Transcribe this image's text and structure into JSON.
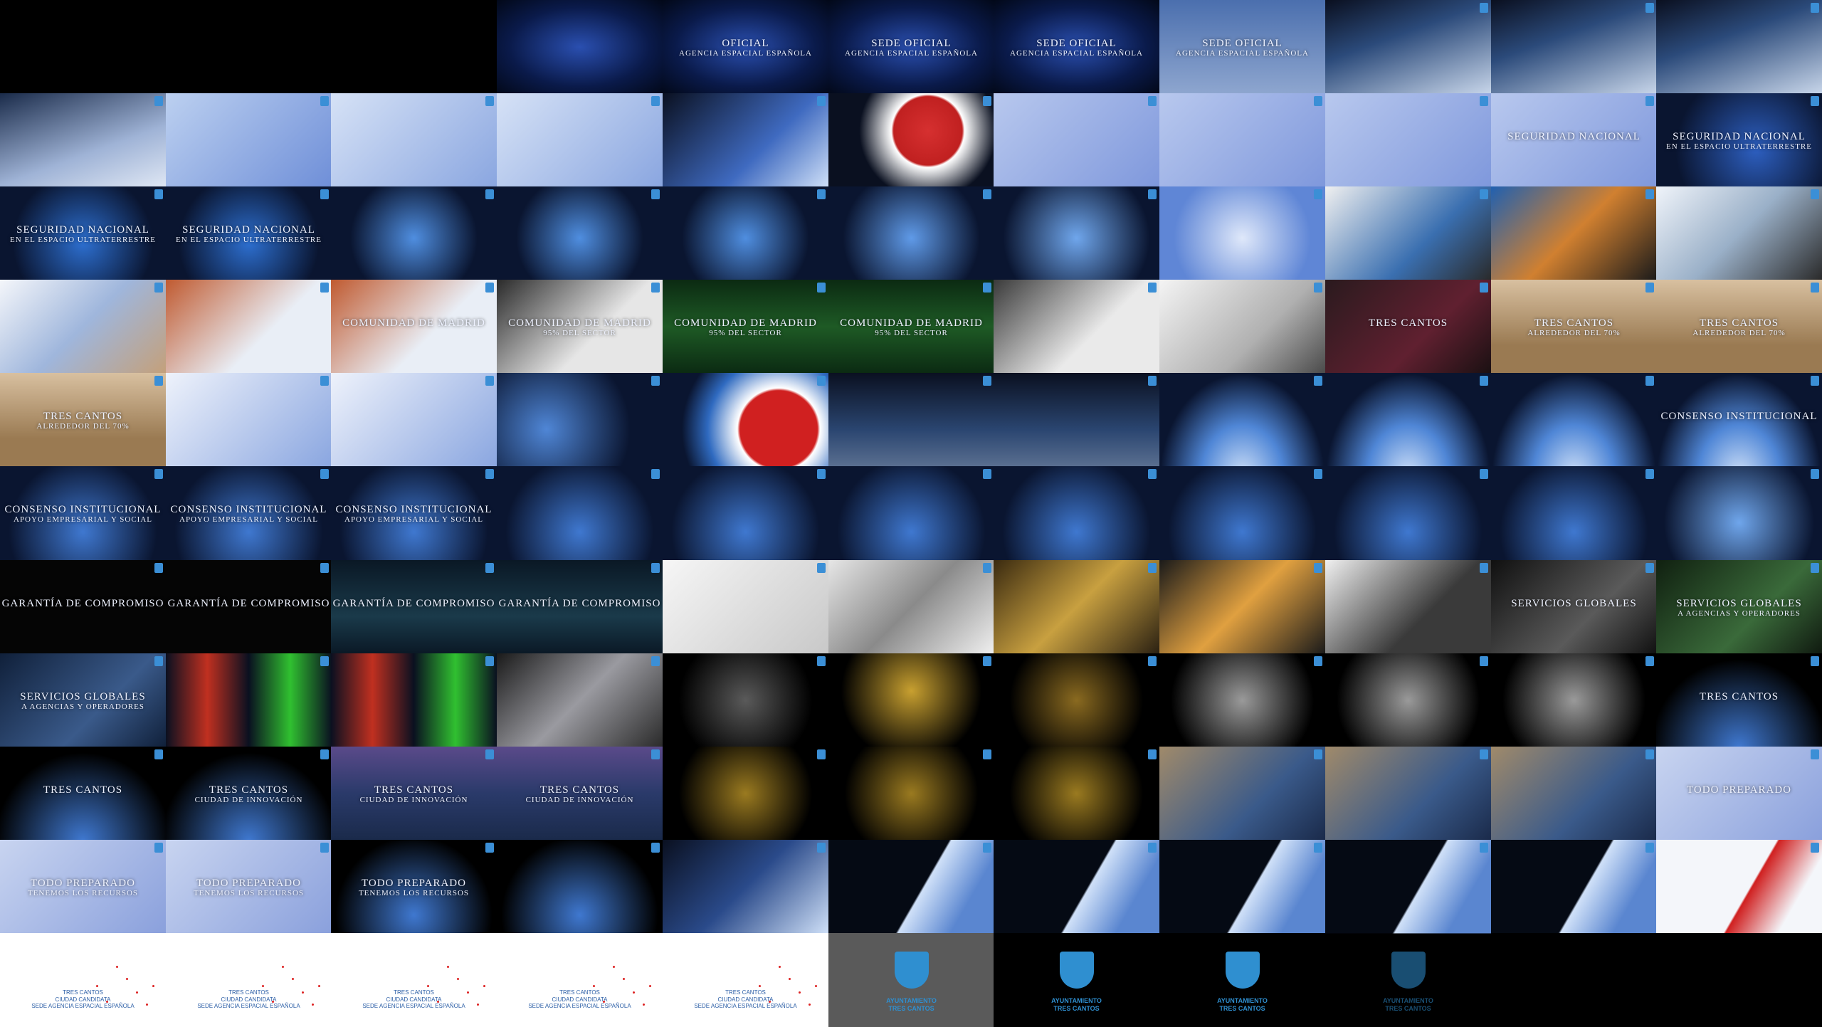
{
  "grid": {
    "cols": 11,
    "rows": 11
  },
  "frames": [
    {
      "bg": "#000"
    },
    {
      "bg": "#000"
    },
    {
      "bg": "#000"
    },
    {
      "bg": "radial-gradient(ellipse at center,#2a4fb0 0%,#0a1a4a 60%,#020818 100%)",
      "cap": "",
      "sub": ""
    },
    {
      "bg": "radial-gradient(ellipse at center,#2a4fb0 0%,#0a1a4a 60%,#020818 100%)",
      "cap": "OFICIAL",
      "sub": "AGENCIA ESPACIAL ESPAÑOLA"
    },
    {
      "bg": "radial-gradient(ellipse at center,#2a4fb0 0%,#0a1a4a 60%,#020818 100%)",
      "cap": "SEDE OFICIAL",
      "sub": "AGENCIA ESPACIAL ESPAÑOLA"
    },
    {
      "bg": "radial-gradient(ellipse at center,#2a4fb0 0%,#0a1a4a 60%,#020818 100%)",
      "cap": "SEDE OFICIAL",
      "sub": "AGENCIA ESPACIAL ESPAÑOLA"
    },
    {
      "bg": "linear-gradient(#4b6fae,#8ea6cf)",
      "cap": "SEDE OFICIAL",
      "sub": "AGENCIA ESPACIAL ESPAÑOLA"
    },
    {
      "bg": "linear-gradient(160deg,#0a0f1f 0%,#2b4a7a 40%,#c8d6ea 100%)",
      "badge": true
    },
    {
      "bg": "linear-gradient(160deg,#0a0f1f 0%,#2b4a7a 40%,#c8d6ea 100%)",
      "badge": true
    },
    {
      "bg": "linear-gradient(160deg,#0a0f1f 0%,#2b4a7a 40%,#c8d6ea 100%)",
      "badge": true
    },
    {
      "bg": "linear-gradient(160deg,#1a2b4a,#9fb3d6 60%,#dfe7f4)",
      "badge": true
    },
    {
      "bg": "linear-gradient(135deg,#bcd0f0,#6f8fd8)",
      "badge": true
    },
    {
      "bg": "linear-gradient(135deg,#d6e2f6,#8aa6e0)",
      "badge": true
    },
    {
      "bg": "linear-gradient(135deg,#d6e2f6,#8aa6e0)",
      "badge": true
    },
    {
      "bg": "linear-gradient(135deg,#0a1020,#3f6ac0 60%,#cfe0f8)",
      "badge": true
    },
    {
      "bg": "radial-gradient(circle at 60% 40%,#d63030 0%,#c02020 30%,#ffffff 32%,#0a1020 60%)",
      "badge": true
    },
    {
      "bg": "linear-gradient(135deg,#b8c8ee,#7f98dc)",
      "badge": true
    },
    {
      "bg": "linear-gradient(135deg,#b8c8ee,#7f98dc)",
      "badge": true
    },
    {
      "bg": "linear-gradient(135deg,#b8c8ee,#7f98dc)",
      "badge": true
    },
    {
      "bg": "linear-gradient(135deg,#b8c8ee,#7f98dc)",
      "badge": true,
      "cap": "SEGURIDAD NACIONAL"
    },
    {
      "bg": "radial-gradient(circle at 60% 60%,#2d5fc0,#0a1530 70%)",
      "badge": true,
      "cap": "SEGURIDAD NACIONAL",
      "sub": "EN EL ESPACIO ULTRATERRESTRE"
    },
    {
      "bg": "radial-gradient(circle at 50% 60%,#2d6fd0,#0a1530 70%)",
      "badge": true,
      "cap": "SEGURIDAD NACIONAL",
      "sub": "EN EL ESPACIO ULTRATERRESTRE"
    },
    {
      "bg": "radial-gradient(circle at 50% 60%,#2d6fd0,#0a1530 70%)",
      "badge": true,
      "cap": "SEGURIDAD NACIONAL",
      "sub": "EN EL ESPACIO ULTRATERRESTRE"
    },
    {
      "bg": "radial-gradient(circle at 50% 55%,#4f8ee0,#0a1530 65%)",
      "badge": true
    },
    {
      "bg": "radial-gradient(circle at 50% 55%,#4f8ee0,#0a1530 65%)",
      "badge": true
    },
    {
      "bg": "radial-gradient(circle at 50% 55%,#4f8ee0,#0a1530 65%)",
      "badge": true
    },
    {
      "bg": "radial-gradient(circle at 50% 55%,#5f9ae8,#0a1530 70%)",
      "badge": true
    },
    {
      "bg": "radial-gradient(circle at 50% 55%,#6fa6ec,#0a1530 75%)",
      "badge": true
    },
    {
      "bg": "radial-gradient(circle at 50% 55%,#dfe8fa,#5f86d6 70%)",
      "badge": true
    },
    {
      "bg": "linear-gradient(135deg,#f0f0f0,#3a6fb0 60%,#2a2a2a)",
      "badge": true
    },
    {
      "bg": "linear-gradient(135deg,#2060b0,#d08030 50%,#1a1a1a)",
      "badge": true
    },
    {
      "bg": "linear-gradient(135deg,#f0f4fa,#9ab0c8 50%,#2a2a2a)",
      "badge": true
    },
    {
      "bg": "linear-gradient(135deg,#f4f6fa,#9fb6dc 50%,#c4a07a)",
      "badge": true
    },
    {
      "bg": "linear-gradient(135deg,#c05a30,#e9eef6 60%)",
      "badge": true
    },
    {
      "bg": "linear-gradient(135deg,#c05a30,#e9eef6 60%)",
      "badge": true,
      "cap": "COMUNIDAD DE MADRID"
    },
    {
      "bg": "linear-gradient(135deg,#2a2a2a,#e6e6e6 60%)",
      "badge": true,
      "cap": "COMUNIDAD DE MADRID",
      "sub": "95% DEL SECTOR"
    },
    {
      "bg": "linear-gradient(#0b2a12,#1e5a25 50%,#0b2a12)",
      "badge": true,
      "cap": "COMUNIDAD DE MADRID",
      "sub": "95% DEL SECTOR"
    },
    {
      "bg": "linear-gradient(#0b2a12,#1e5a25 50%,#0b2a12)",
      "badge": true,
      "cap": "COMUNIDAD DE MADRID",
      "sub": "95% DEL SECTOR"
    },
    {
      "bg": "linear-gradient(135deg,#3a3a3a,#eaeaea 60%)",
      "badge": true
    },
    {
      "bg": "linear-gradient(135deg,#f4f4f4,#b0b0b0 60%,#4a4a4a)",
      "badge": true
    },
    {
      "bg": "linear-gradient(135deg,#2a1a1e,#602030 60%,#1a1012)",
      "badge": true,
      "cap": "TRES CANTOS"
    },
    {
      "bg": "linear-gradient(#d8c0a0,#9a7a52 70%)",
      "badge": true,
      "cap": "TRES CANTOS",
      "sub": "ALREDEDOR DEL 70%"
    },
    {
      "bg": "linear-gradient(#d8c0a0,#9a7a52 70%)",
      "badge": true,
      "cap": "TRES CANTOS",
      "sub": "ALREDEDOR DEL 70%"
    },
    {
      "bg": "linear-gradient(#d8c0a0,#9a7a52 70%)",
      "badge": true,
      "cap": "TRES CANTOS",
      "sub": "ALREDEDOR DEL 70%"
    },
    {
      "bg": "linear-gradient(135deg,#eef2fb,#8aa6e0)",
      "badge": true
    },
    {
      "bg": "linear-gradient(135deg,#eef2fb,#8aa6e0)",
      "badge": true
    },
    {
      "bg": "radial-gradient(circle at 30% 60%,#4f86d6,#0a1530 65%)",
      "badge": true
    },
    {
      "bg": "radial-gradient(circle at 70% 60%,#d02020 0%,#d02020 30%,#ffffff 32%,#2f6ac0 55%,#0a1530 75%)",
      "badge": true
    },
    {
      "bg": "linear-gradient(#0a1020,#2a4570 60%,#5a6f90)",
      "badge": true
    },
    {
      "bg": "linear-gradient(#0a1020,#2a4570 60%,#5a6f90)",
      "badge": true
    },
    {
      "bg": "radial-gradient(ellipse at 50% 110%,#cfe0f8 0%,#4f86d6 35%,#0a1530 70%)",
      "badge": true
    },
    {
      "bg": "radial-gradient(ellipse at 50% 110%,#cfe0f8 0%,#4f86d6 35%,#0a1530 70%)",
      "badge": true
    },
    {
      "bg": "radial-gradient(ellipse at 50% 110%,#cfe0f8 0%,#4f86d6 35%,#0a1530 70%)",
      "badge": true
    },
    {
      "bg": "radial-gradient(ellipse at 50% 110%,#cfe0f8 0%,#4f86d6 35%,#0a1530 70%)",
      "badge": true,
      "cap": "CONSENSO INSTITUCIONAL"
    },
    {
      "bg": "radial-gradient(circle at 50% 70%,#3f78d0,#0a1530 70%)",
      "badge": true,
      "cap": "CONSENSO INSTITUCIONAL",
      "sub": "APOYO EMPRESARIAL Y SOCIAL"
    },
    {
      "bg": "radial-gradient(circle at 50% 70%,#3f78d0,#0a1530 70%)",
      "badge": true,
      "cap": "CONSENSO INSTITUCIONAL",
      "sub": "APOYO EMPRESARIAL Y SOCIAL"
    },
    {
      "bg": "radial-gradient(circle at 50% 70%,#3f78d0,#0a1530 70%)",
      "badge": true,
      "cap": "CONSENSO INSTITUCIONAL",
      "sub": "APOYO EMPRESARIAL Y SOCIAL"
    },
    {
      "bg": "radial-gradient(circle at 50% 70%,#3f78d0,#0a1530 70%)",
      "badge": true
    },
    {
      "bg": "radial-gradient(circle at 50% 70%,#3f78d0,#0a1530 70%)",
      "badge": true
    },
    {
      "bg": "radial-gradient(circle at 50% 70%,#3f78d0,#0a1530 70%)",
      "badge": true
    },
    {
      "bg": "radial-gradient(circle at 50% 70%,#3f78d0,#0a1530 70%)",
      "badge": true
    },
    {
      "bg": "radial-gradient(circle at 50% 70%,#3f78d0,#0a1530 70%)",
      "badge": true
    },
    {
      "bg": "radial-gradient(circle at 50% 70%,#3f78d0,#0a1530 70%)",
      "badge": true
    },
    {
      "bg": "radial-gradient(circle at 50% 70%,#3f78d0,#0a1530 70%)",
      "badge": true
    },
    {
      "bg": "radial-gradient(circle at 50% 60%,#6fa6ec,#0a1530 75%)",
      "badge": true
    },
    {
      "bg": "#050505",
      "badge": true,
      "cap": "GARANTÍA DE COMPROMISO"
    },
    {
      "bg": "#050505",
      "badge": true,
      "cap": "GARANTÍA DE COMPROMISO"
    },
    {
      "bg": "linear-gradient(#0a1825,#1a3a4a 60%,#0a1825)",
      "badge": true,
      "cap": "GARANTÍA DE COMPROMISO"
    },
    {
      "bg": "linear-gradient(#0a1825,#1a3a4a 60%,#0a1825)",
      "badge": true,
      "cap": "GARANTÍA DE COMPROMISO"
    },
    {
      "bg": "linear-gradient(135deg,#f6f6f6,#c8c8c8)",
      "badge": true
    },
    {
      "bg": "linear-gradient(135deg,#e6e6e6,#8a8a8a 50%,#f0f0f0)",
      "badge": true
    },
    {
      "bg": "linear-gradient(135deg,#3a2a10,#c8a040 50%,#2a2012)",
      "badge": true
    },
    {
      "bg": "linear-gradient(135deg,#1a1a1a,#e0a040 50%,#1a1a1a)",
      "badge": true
    },
    {
      "bg": "linear-gradient(135deg,#f0f0f0,#3a3a3a 60%)",
      "badge": true
    },
    {
      "bg": "linear-gradient(135deg,#101010,#5a5a5a 60%,#101010)",
      "badge": true,
      "cap": "SERVICIOS GLOBALES"
    },
    {
      "bg": "linear-gradient(135deg,#102010,#3a6a3a 60%,#101a10)",
      "badge": true,
      "cap": "SERVICIOS GLOBALES",
      "sub": "A AGENCIAS Y OPERADORES"
    },
    {
      "bg": "linear-gradient(135deg,#10203a,#3a5a8a 60%,#10203a)",
      "badge": true,
      "cap": "SERVICIOS GLOBALES",
      "sub": "A AGENCIAS Y OPERADORES"
    },
    {
      "bg": "linear-gradient(90deg,#0a1020 0%,#c03020 25%,#0a1020 50%,#30c030 75%,#0a1020 100%)",
      "badge": true
    },
    {
      "bg": "linear-gradient(90deg,#0a1020 0%,#c03020 25%,#0a1020 50%,#30c030 75%,#0a1020 100%)",
      "badge": true
    },
    {
      "bg": "linear-gradient(135deg,#1a1a1a,#9a9aa0 50%,#2a2a2a)",
      "badge": true
    },
    {
      "bg": "radial-gradient(circle at 50% 50%,#5a5a5a,#000 70%)",
      "badge": true
    },
    {
      "bg": "radial-gradient(circle at 50% 40%,#c8a030,#000 70%)",
      "badge": true
    },
    {
      "bg": "radial-gradient(circle at 50% 50%,#8a6a20,#000 70%)",
      "badge": true
    },
    {
      "bg": "radial-gradient(circle at 50% 50%,#9a9a9a,#000 75%)",
      "badge": true
    },
    {
      "bg": "radial-gradient(circle at 50% 50%,#9a9a9a,#000 75%)",
      "badge": true
    },
    {
      "bg": "radial-gradient(circle at 50% 50%,#9a9a9a,#000 75%)",
      "badge": true
    },
    {
      "bg": "radial-gradient(circle at 50% 100%,#3f78d0,#000 70%)",
      "badge": true,
      "cap": "TRES CANTOS"
    },
    {
      "bg": "radial-gradient(circle at 50% 100%,#3f78d0,#000 70%)",
      "badge": true,
      "cap": "TRES CANTOS"
    },
    {
      "bg": "radial-gradient(circle at 50% 100%,#3f78d0,#000 70%)",
      "badge": true,
      "cap": "TRES CANTOS",
      "sub": "CIUDAD DE INNOVACIÓN"
    },
    {
      "bg": "linear-gradient(#5a4a8a,#2a3a6a 50%,#1a2a4a)",
      "badge": true,
      "cap": "TRES CANTOS",
      "sub": "CIUDAD DE INNOVACIÓN"
    },
    {
      "bg": "linear-gradient(#5a4a8a,#2a3a6a 50%,#1a2a4a)",
      "badge": true,
      "cap": "TRES CANTOS",
      "sub": "CIUDAD DE INNOVACIÓN"
    },
    {
      "bg": "radial-gradient(circle at 50% 50%,#9a7a20,#000 70%)",
      "badge": true
    },
    {
      "bg": "radial-gradient(circle at 50% 50%,#9a7a20,#000 70%)",
      "badge": true
    },
    {
      "bg": "radial-gradient(circle at 50% 50%,#9a7a20,#000 70%)",
      "badge": true
    },
    {
      "bg": "linear-gradient(135deg,#a08a6a,#3a5a8a 60%,#1a2a4a)",
      "badge": true
    },
    {
      "bg": "linear-gradient(135deg,#a08a6a,#3a5a8a 60%,#1a2a4a)",
      "badge": true
    },
    {
      "bg": "linear-gradient(135deg,#a08a6a,#3a5a8a 60%,#1a2a4a)",
      "badge": true
    },
    {
      "bg": "linear-gradient(135deg,#c8d4f0,#8aa0dc)",
      "badge": true,
      "cap": "TODO PREPARADO"
    },
    {
      "bg": "linear-gradient(135deg,#c8d4f0,#8aa0dc)",
      "badge": true,
      "cap": "TODO PREPARADO",
      "sub": "TENEMOS LOS RECURSOS"
    },
    {
      "bg": "linear-gradient(135deg,#c8d4f0,#8aa0dc)",
      "badge": true,
      "cap": "TODO PREPARADO",
      "sub": "TENEMOS LOS RECURSOS"
    },
    {
      "bg": "radial-gradient(circle at 50% 80%,#3f78d0,#000 70%)",
      "badge": true,
      "cap": "TODO PREPARADO",
      "sub": "TENEMOS LOS RECURSOS"
    },
    {
      "bg": "radial-gradient(circle at 50% 80%,#3f78d0,#000 70%)",
      "badge": true
    },
    {
      "bg": "linear-gradient(135deg,#0a1020 0%,#2a4a8a 50%,#cfe0f8 100%)",
      "badge": true
    },
    {
      "bg": "linear-gradient(120deg,#050a14 55%,#cfe0f8 56%,#5a86d0 80%)",
      "badge": true
    },
    {
      "bg": "linear-gradient(120deg,#050a14 55%,#cfe0f8 56%,#5a86d0 80%)",
      "badge": true
    },
    {
      "bg": "linear-gradient(120deg,#050a14 55%,#cfe0f8 56%,#5a86d0 80%)",
      "badge": true
    },
    {
      "bg": "linear-gradient(120deg,#050a14 55%,#cfe0f8 56%,#5a86d0 80%)",
      "badge": true
    },
    {
      "bg": "linear-gradient(120deg,#050a14 55%,#cfe0f8 56%,#5a86d0 80%)",
      "badge": true
    },
    {
      "bg": "linear-gradient(120deg,#f4f6fa 55%,#d02020 56%,#f4f6fa 80%)",
      "badge": true
    },
    {
      "bg": "#ffffff",
      "logo": "TRES CANTOS|CIUDAD CANDIDATA|SEDE AGENCIA ESPACIAL ESPAÑOLA",
      "dots": true
    },
    {
      "bg": "#ffffff",
      "logo": "TRES CANTOS|CIUDAD CANDIDATA|SEDE AGENCIA ESPACIAL ESPAÑOLA",
      "dots": true
    },
    {
      "bg": "#ffffff",
      "logo": "TRES CANTOS|CIUDAD CANDIDATA|SEDE AGENCIA ESPACIAL ESPAÑOLA",
      "dots": true
    },
    {
      "bg": "#ffffff",
      "logo": "TRES CANTOS|CIUDAD CANDIDATA|SEDE AGENCIA ESPACIAL ESPAÑOLA",
      "dots": true
    },
    {
      "bg": "#ffffff",
      "logo": "TRES CANTOS|CIUDAD CANDIDATA|SEDE AGENCIA ESPACIAL ESPAÑOLA",
      "dots": true
    },
    {
      "bg": "#5a5a5a",
      "shield": "AYUNTAMIENTO|TRES CANTOS"
    },
    {
      "bg": "#000",
      "shield": "AYUNTAMIENTO|TRES CANTOS"
    },
    {
      "bg": "#000",
      "shield": "AYUNTAMIENTO|TRES CANTOS"
    },
    {
      "bg": "#000",
      "shield": "AYUNTAMIENTO|TRES CANTOS",
      "dim": true
    },
    {
      "bg": "#000"
    },
    {
      "bg": "#000"
    }
  ]
}
